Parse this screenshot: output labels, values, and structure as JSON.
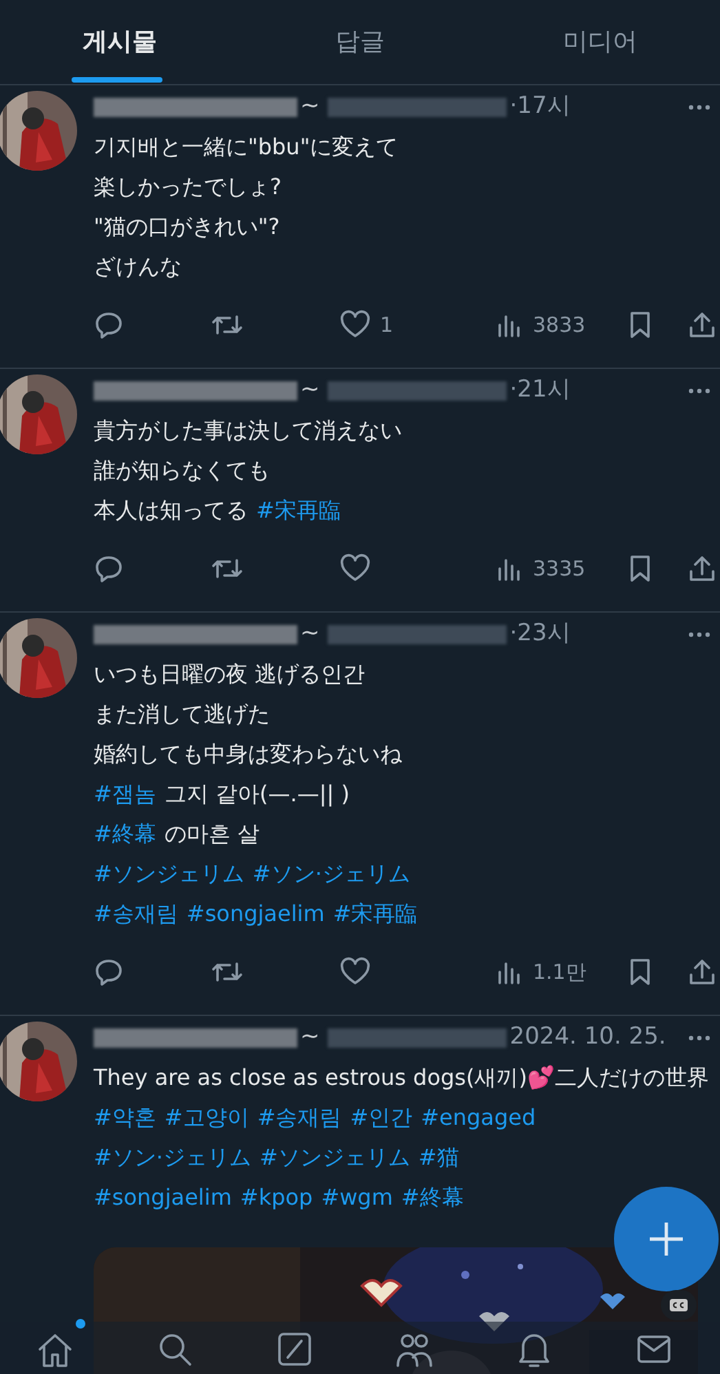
{
  "tabs": [
    {
      "label": "게시물",
      "selected": true
    },
    {
      "label": "답글",
      "selected": false
    },
    {
      "label": "미디어",
      "selected": false
    }
  ],
  "posts": [
    {
      "separator": "~",
      "time": "·17시",
      "lines": [
        [
          {
            "kind": "text",
            "text": "기지배と一緒に\"bbu\"に変えて"
          }
        ],
        [
          {
            "kind": "text",
            "text": "楽しかったでしょ?"
          }
        ],
        [
          {
            "kind": "text",
            "text": "\"猫の口がきれい\"?"
          }
        ],
        [
          {
            "kind": "text",
            "text": "ざけんな"
          }
        ]
      ],
      "likes": "1",
      "views": "3833"
    },
    {
      "separator": "~",
      "time": "·21시",
      "lines": [
        [
          {
            "kind": "text",
            "text": "貴方がした事は決して消えない"
          }
        ],
        [
          {
            "kind": "text",
            "text": "誰が知らなくても"
          }
        ],
        [
          {
            "kind": "text",
            "text": "本人は知ってる"
          },
          {
            "kind": "hashtag",
            "text": "#宋再臨"
          }
        ]
      ],
      "views": "3335"
    },
    {
      "separator": "~",
      "time": "·23시",
      "lines": [
        [
          {
            "kind": "text",
            "text": "いつも日曜の夜 逃げる인간"
          }
        ],
        [
          {
            "kind": "text",
            "text": "また消して逃げた"
          }
        ],
        [
          {
            "kind": "text",
            "text": "婚約しても中身は変わらないね"
          }
        ],
        [
          {
            "kind": "hashtag",
            "text": "#잼놈"
          },
          {
            "kind": "text",
            "text": "그지 같아(—.—|| )"
          }
        ],
        [
          {
            "kind": "hashtag",
            "text": "#終幕"
          },
          {
            "kind": "text",
            "text": "の마흔 살"
          }
        ],
        [
          {
            "kind": "hashtag",
            "text": "#ソンジェリム"
          },
          {
            "kind": "hashtag",
            "text": "#ソン·ジェリム"
          }
        ],
        [
          {
            "kind": "hashtag",
            "text": "#송재림"
          },
          {
            "kind": "hashtag",
            "text": "#songjaelim"
          },
          {
            "kind": "hashtag",
            "text": "#宋再臨"
          }
        ]
      ],
      "views": "1.1만"
    },
    {
      "separator": "~",
      "time": "2024. 10. 25.",
      "lines": [
        [
          {
            "kind": "text",
            "text": "They are as close as estrous dogs(새끼)💕二人だけの世界"
          }
        ],
        [
          {
            "kind": "hashtag",
            "text": "#약혼"
          },
          {
            "kind": "hashtag",
            "text": "#고양이"
          },
          {
            "kind": "hashtag",
            "text": "#송재림"
          },
          {
            "kind": "hashtag",
            "text": "#인간"
          },
          {
            "kind": "hashtag",
            "text": "#engaged"
          }
        ],
        [
          {
            "kind": "hashtag",
            "text": "#ソン·ジェリム"
          },
          {
            "kind": "hashtag",
            "text": "#ソンジェリム"
          },
          {
            "kind": "hashtag",
            "text": "#猫"
          }
        ],
        [
          {
            "kind": "hashtag",
            "text": "#songjaelim"
          },
          {
            "kind": "hashtag",
            "text": "#kpop"
          },
          {
            "kind": "hashtag",
            "text": "#wgm"
          },
          {
            "kind": "hashtag",
            "text": "#終幕"
          }
        ]
      ],
      "media": {
        "kind": "picture"
      }
    }
  ],
  "nav": [
    {
      "kind": "home",
      "badge": true
    },
    {
      "kind": "search",
      "badge": false
    },
    {
      "kind": "compose",
      "badge": false
    },
    {
      "kind": "people",
      "badge": false
    },
    {
      "kind": "bell",
      "badge": false
    },
    {
      "kind": "mail",
      "badge": false
    }
  ]
}
